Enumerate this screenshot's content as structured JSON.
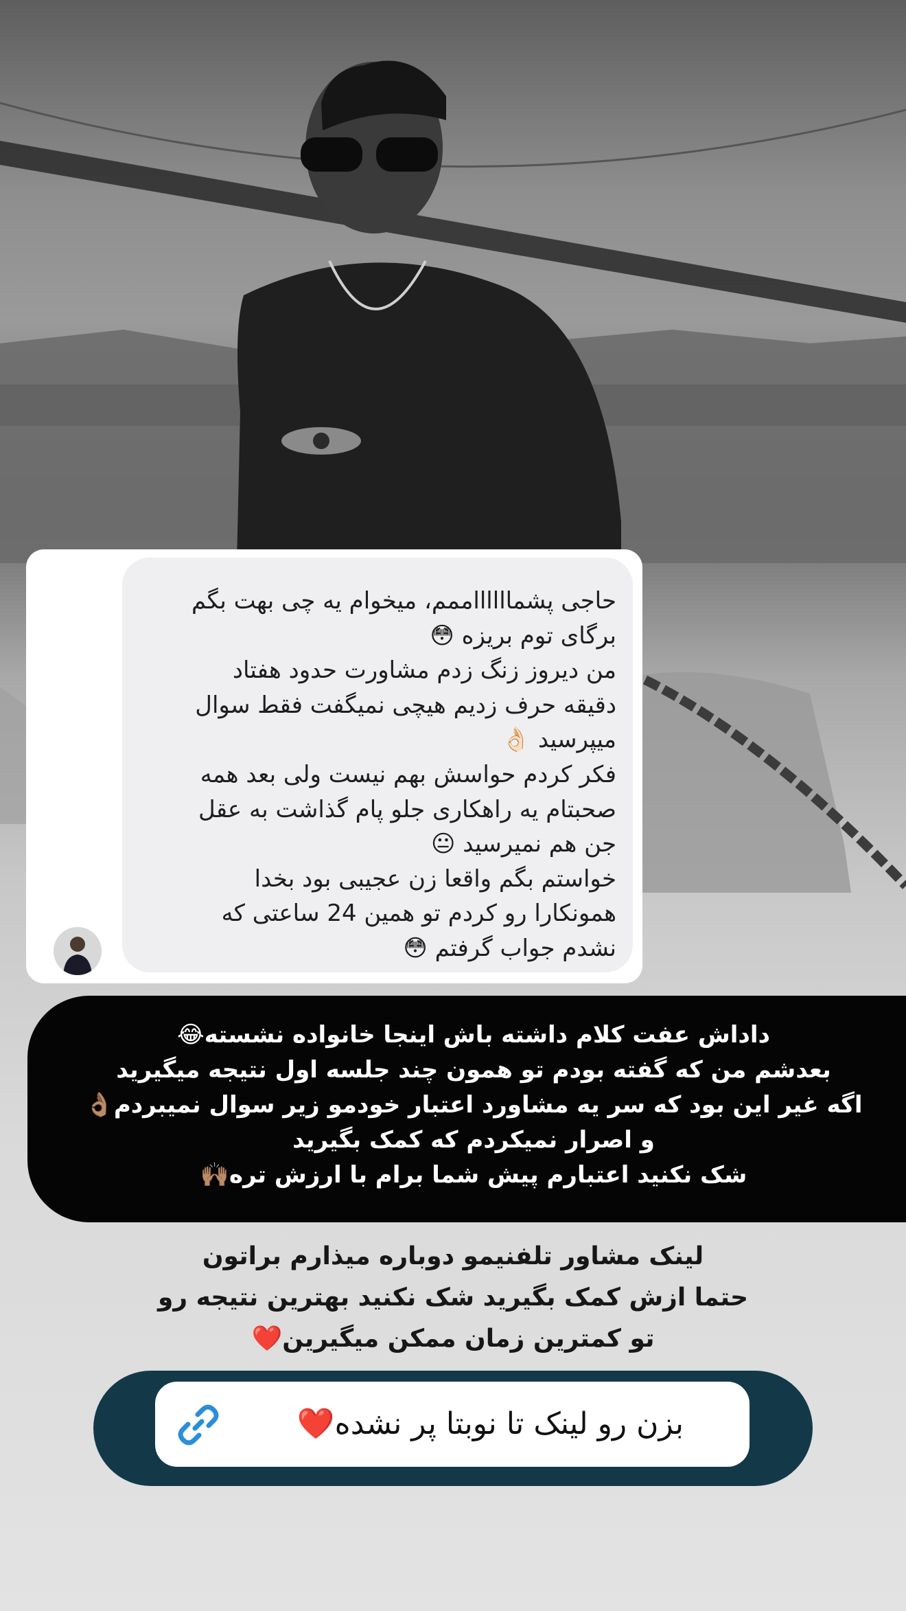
{
  "message_bubble": {
    "lines": [
      "حاجی پشمااااااممم، میخوام یه چی بهت بگم",
      "برگای توم بریزه 😳",
      "من دیروز زنگ زدم مشاورت حدود هفتاد",
      "دقیقه حرف زدیم هیچی نمیگفت فقط سوال",
      "میپرسید 👌🏻",
      "فکر کردم حواسش بهم نیست ولی بعد همه",
      "صحبتام یه راهکاری جلو پام گذاشت به عقل",
      "جن هم نمیرسید 😐",
      "خواستم بگم واقعا زن عجیبی بود بخدا",
      "همونکارا رو کردم تو همین 24 ساعتی که",
      "نشدم جواب گرفتم 😳"
    ]
  },
  "reply": {
    "lines": [
      "داداش عفت کلام داشته باش اینجا خانواده نشسته😂",
      "بعدشم من که گفته بودم تو همون چند جلسه اول نتیجه میگیرید",
      "اگه غیر این بود که سر یه مشاورد اعتبار خودمو زیر سوال نمیبردم👌🏽",
      "و اصرار نمیکردم که کمک بگیرید",
      "شک نکنید اعتبارم پیش شما برام با ارزش تره🙌🏽"
    ]
  },
  "caption": {
    "lines": [
      "لینک مشاور تلفنیمو دوباره میذارم براتون",
      "حتما ازش کمک بگیرید شک نکنید بهترین نتیجه رو",
      "تو کمترین زمان ممکن میگیرین❤️"
    ]
  },
  "link_sticker": {
    "text": "بزن رو لینک تا نوبتا پر نشده❤️",
    "icon": "link-icon",
    "icon_color": "#2a8fd6"
  },
  "colors": {
    "reply_card": "#050505",
    "link_pill": "#133949",
    "bubble_bg": "#efeff1"
  }
}
